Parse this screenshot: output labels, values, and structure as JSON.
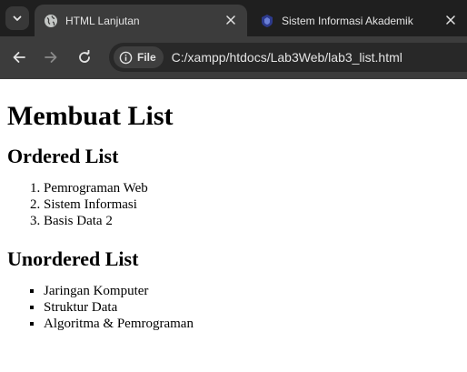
{
  "browser": {
    "tabs": [
      {
        "title": "HTML Lanjutan",
        "active": true,
        "favicon": "globe-icon"
      },
      {
        "title": "Sistem Informasi Akademik",
        "active": false,
        "favicon": "crest-icon"
      }
    ],
    "address": {
      "chip_label": "File",
      "url": "C:/xampp/htdocs/Lab3Web/lab3_list.html"
    }
  },
  "page": {
    "title": "Membuat List",
    "ordered_heading": "Ordered List",
    "ordered_items": [
      "Pemrograman Web",
      "Sistem Informasi",
      "Basis Data 2"
    ],
    "unordered_heading": "Unordered List",
    "unordered_items": [
      "Jaringan Komputer",
      "Struktur Data",
      "Algoritma & Pemrograman"
    ]
  },
  "colors": {
    "tabstrip_bg": "#1f1f1f",
    "toolbar_bg": "#3c3c3c",
    "text_light": "#e3e3e3"
  }
}
